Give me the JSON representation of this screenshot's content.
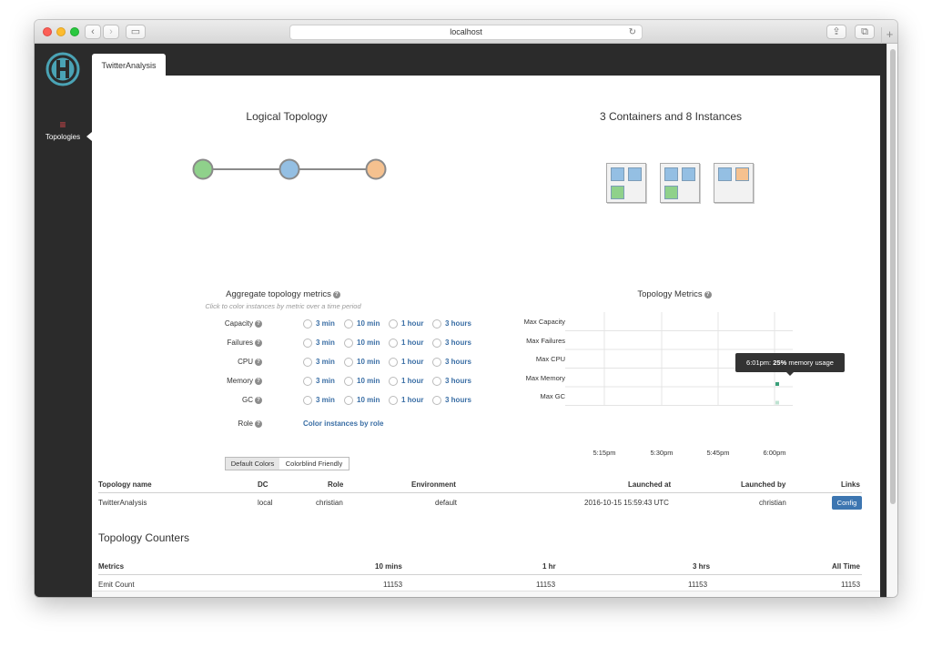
{
  "browser": {
    "url": "localhost",
    "reload_icon": "↻",
    "back_icon": "‹",
    "forward_icon": "›",
    "new_tab_icon": "+",
    "share_icon": "⇪",
    "tabs_icon": "⧉",
    "sidebar_icon": "▭"
  },
  "sidebar": {
    "logo": "heron-logo-icon",
    "nav_icon": "≡",
    "nav_label": "Topologies"
  },
  "tab": {
    "label": "TwitterAnalysis"
  },
  "logical_topology": {
    "title": "Logical Topology",
    "nodes": [
      {
        "color": "#8fd18b"
      },
      {
        "color": "#94bfe3"
      },
      {
        "color": "#f5c18f"
      }
    ]
  },
  "physical_plan": {
    "title": "3 Containers and 8 Instances",
    "containers": [
      {
        "instances": [
          "#94bfe3",
          "#94bfe3",
          "#8fd18b"
        ]
      },
      {
        "instances": [
          "#94bfe3",
          "#94bfe3",
          "#8fd18b"
        ]
      },
      {
        "instances": [
          "#94bfe3",
          "#f5c18f"
        ]
      }
    ]
  },
  "aggregate": {
    "title": "Aggregate topology metrics",
    "help": "?",
    "subtitle": "Click to color instances by metric over a time period",
    "options": [
      "3 min",
      "10 min",
      "1 hour",
      "3 hours"
    ],
    "metrics": [
      "Capacity",
      "Failures",
      "CPU",
      "Memory",
      "GC"
    ],
    "role_label": "Role",
    "role_link": "Color instances by role",
    "color_buttons": [
      "Default Colors",
      "Colorblind Friendly"
    ]
  },
  "topology_metrics": {
    "title": "Topology Metrics",
    "tooltip": {
      "time": "6:01pm:",
      "value": "25%",
      "suffix": "memory usage"
    }
  },
  "chart_data": {
    "type": "heatmap",
    "title": "Topology Metrics",
    "rows": [
      "Max Capacity",
      "Max Failures",
      "Max CPU",
      "Max Memory",
      "Max GC"
    ],
    "x_ticks": [
      "5:15pm",
      "5:30pm",
      "5:45pm",
      "6:00pm"
    ],
    "x_range_minutes": [
      0,
      60
    ],
    "grid": true,
    "points": [
      {
        "row": "Max Memory",
        "time": "6:01pm",
        "value": 25,
        "unit": "%"
      },
      {
        "row": "Max GC",
        "time": "6:01pm"
      }
    ]
  },
  "topology_info": {
    "headers": [
      "Topology name",
      "DC",
      "Role",
      "Environment",
      "Launched at",
      "Launched by",
      "Links"
    ],
    "row": [
      "TwitterAnalysis",
      "local",
      "christian",
      "default",
      "2016-10-15 15:59:43 UTC",
      "christian"
    ],
    "config_label": "Config"
  },
  "counters": {
    "title": "Topology Counters",
    "headers": [
      "Metrics",
      "10 mins",
      "1 hr",
      "3 hrs",
      "All Time"
    ],
    "rows": [
      [
        "Emit Count",
        "11153",
        "11153",
        "11153",
        "11153"
      ]
    ]
  },
  "colors": {
    "sidebar_bg": "#2b2b2b",
    "link_blue": "#3a6ea5",
    "button_blue": "#3d76b1",
    "nav_icon_red": "#e5484d",
    "memory_cell": "#3aa07a",
    "gc_cell": "#bfe3d2"
  }
}
